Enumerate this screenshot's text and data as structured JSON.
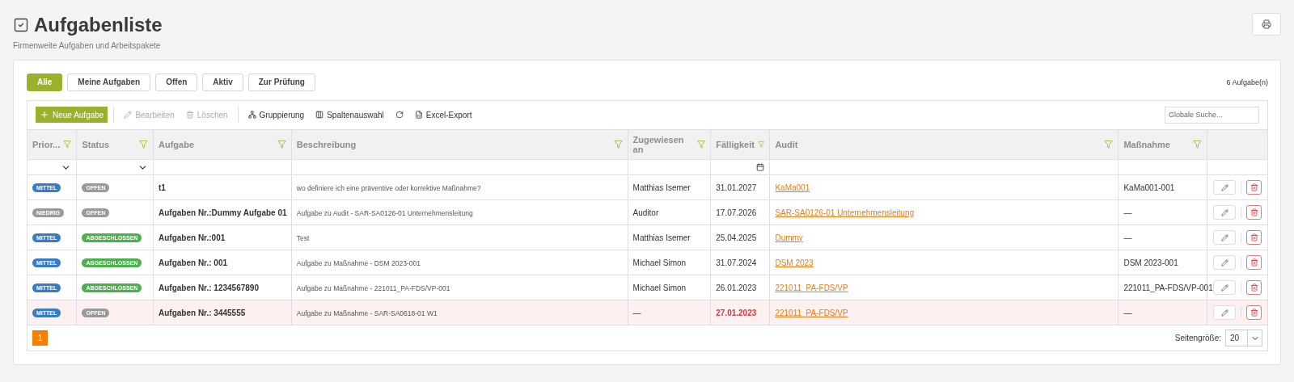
{
  "page": {
    "title": "Aufgabenliste",
    "subtitle": "Firmenweite Aufgaben und Arbeitspakete"
  },
  "filter_tabs": [
    {
      "label": "Alle",
      "selected": true
    },
    {
      "label": "Meine Aufgaben",
      "selected": false
    },
    {
      "label": "Offen",
      "selected": false
    },
    {
      "label": "Aktiv",
      "selected": false
    },
    {
      "label": "Zur Prüfung",
      "selected": false
    }
  ],
  "count": "6 Aufgabe(n)",
  "toolbar": [
    {
      "kind": "new",
      "label": "Neue Aufgabe",
      "disabled": false
    },
    {
      "kind": "separator"
    },
    {
      "kind": "edit",
      "label": "Bearbeiten",
      "disabled": true
    },
    {
      "kind": "delete",
      "label": "Löschen",
      "disabled": true
    },
    {
      "kind": "separator"
    },
    {
      "kind": "group",
      "label": "Gruppierung",
      "disabled": false
    },
    {
      "kind": "columns",
      "label": "Spaltenauswahl",
      "disabled": false
    },
    {
      "kind": "refresh",
      "disabled": false
    },
    {
      "kind": "export",
      "label": "Excel-Export",
      "disabled": false
    }
  ],
  "search": {
    "placeholder": "Globale Suche..."
  },
  "table": {
    "columns": [
      {
        "label": "Prior..."
      },
      {
        "label": "Status"
      },
      {
        "label": "Aufgabe"
      },
      {
        "label": "Beschreibung"
      },
      {
        "label": "Zugewiesen an"
      },
      {
        "label": "Fälligkeit"
      },
      {
        "label": "Audit"
      },
      {
        "label": "Maßnahme"
      }
    ],
    "rows": [
      {
        "priority": {
          "label": "MITTEL",
          "color": "#3a7cc4"
        },
        "status": {
          "label": "OFFEN",
          "color": "#9a9a9a"
        },
        "task": "t1",
        "description": "wo definiere ich eine präventive oder korrektive Maßnahme?",
        "assignee": "Matthias Isemer",
        "due": "31.01.2027",
        "audit": "KaMa001",
        "measure": "KaMa001-001",
        "overdue": false
      },
      {
        "priority": {
          "label": "NIEDRIG",
          "color": "#9a9a9a"
        },
        "status": {
          "label": "OFFEN",
          "color": "#9a9a9a"
        },
        "task": "Aufgaben Nr.:Dummy Aufgabe 01",
        "description": "Aufgabe zu Audit - SAR-SA0126-01 Unternehmensleitung",
        "assignee": "Auditor",
        "due": "17.07.2026",
        "audit": "SAR-SA0126-01 Unternehmensleitung",
        "measure": "—",
        "overdue": false
      },
      {
        "priority": {
          "label": "MITTEL",
          "color": "#3a7cc4"
        },
        "status": {
          "label": "ABGESCHLOSSEN",
          "color": "#4cb04c"
        },
        "task": "Aufgaben Nr.:001",
        "description": "Test",
        "assignee": "Matthias Isemer",
        "due": "25.04.2025",
        "audit": "Dummy",
        "measure": "—",
        "overdue": false
      },
      {
        "priority": {
          "label": "MITTEL",
          "color": "#3a7cc4"
        },
        "status": {
          "label": "ABGESCHLOSSEN",
          "color": "#4cb04c"
        },
        "task": "Aufgaben Nr.: 001",
        "description": "Aufgabe zu Maßnahme - DSM 2023-001",
        "assignee": "Michael Simon",
        "due": "31.07.2024",
        "audit": "DSM 2023",
        "measure": "DSM 2023-001",
        "overdue": false
      },
      {
        "priority": {
          "label": "MITTEL",
          "color": "#3a7cc4"
        },
        "status": {
          "label": "ABGESCHLOSSEN",
          "color": "#4cb04c"
        },
        "task": "Aufgaben Nr.: 1234567890",
        "description": "Aufgabe zu Maßnahme - 221011_PA-FDS/VP-001",
        "assignee": "Michael Simon",
        "due": "26.01.2023",
        "audit": "221011_PA-FDS/VP",
        "measure": "221011_PA-FDS/VP-001",
        "overdue": false
      },
      {
        "priority": {
          "label": "MITTEL",
          "color": "#3a7cc4"
        },
        "status": {
          "label": "OFFEN",
          "color": "#9a9a9a"
        },
        "task": "Aufgaben Nr.: 3445555",
        "description": "Aufgabe zu Maßnahme - SAR-SA0618-01 W1",
        "assignee": "—",
        "due": "27.01.2023",
        "audit": "221011_PA-FDS/VP",
        "measure": "—",
        "overdue": true
      }
    ]
  },
  "pager": {
    "pages": [
      {
        "label": "1",
        "selected": true
      }
    ],
    "page_size_label": "Seitengröße:",
    "page_size": "20"
  }
}
